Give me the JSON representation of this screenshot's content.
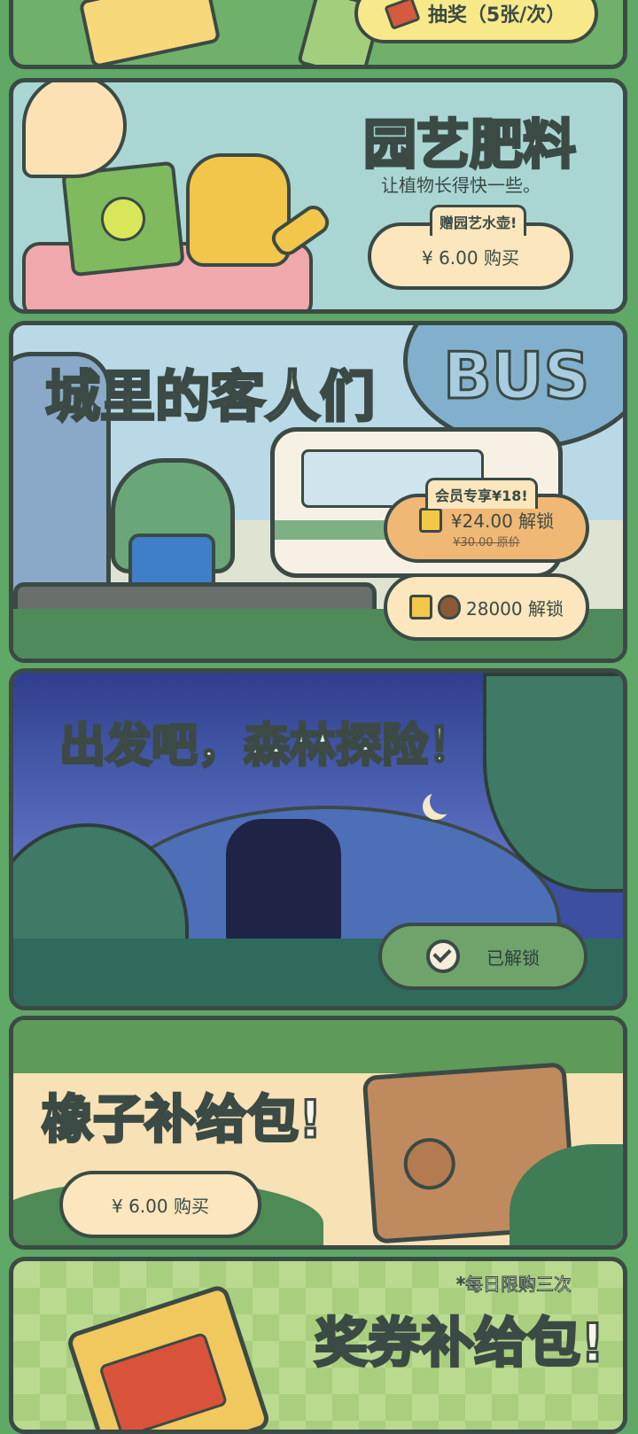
{
  "cards": {
    "lottery": {
      "button_label": "抽奖（5张/次）"
    },
    "garden": {
      "title": "园艺肥料",
      "subtitle": "让植物长得快一些。",
      "ribbon": "赠园艺水壶!",
      "price_button": "¥ 6.00 购买"
    },
    "city": {
      "title": "城里的客人们",
      "bus_sign": "BUS",
      "member_ribbon": "会员专享¥18!",
      "price_button": "¥24.00 解锁",
      "original_price": "¥30.00 原价",
      "acorn_button": "28000 解锁"
    },
    "forest": {
      "title": "出发吧，森林探险！",
      "status_button": "已解锁"
    },
    "acorn_pack": {
      "title": "橡子补给包!",
      "price_button": "¥ 6.00 购买"
    },
    "ticket_pack": {
      "limit_note": "*每日限购三次",
      "title": "奖券补给包!"
    }
  },
  "colors": {
    "background": "#5fa866",
    "outline": "#3b4a45",
    "button_cream": "#fbe6bd",
    "button_orange": "#f0b875",
    "unlocked_green": "#6fa36b"
  }
}
